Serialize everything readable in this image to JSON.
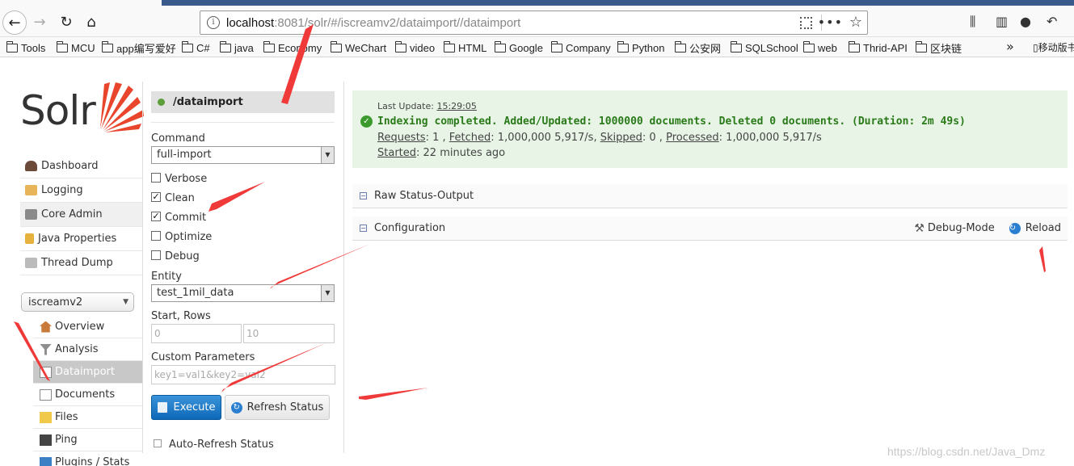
{
  "browser": {
    "url_prefix": "localhost",
    "url_rest": ":8081/solr/#/iscreamv2/dataimport//dataimport",
    "bookmarks": [
      "Tools",
      "MCU",
      "app编写爱好",
      "C#",
      "java",
      "Economy",
      "WeChart",
      "video",
      "HTML",
      "Google",
      "Company",
      "Python",
      "公安网",
      "SQLSchool",
      "web",
      "Thrid-API",
      "区块链"
    ],
    "bookmarks_overflow": "»",
    "mobile_bookmarks": "移动版书签"
  },
  "logo": {
    "text": "Solr"
  },
  "sidebar": {
    "items": [
      "Dashboard",
      "Logging",
      "Core Admin",
      "Java Properties",
      "Thread Dump"
    ],
    "core_selector": "iscreamv2",
    "core_items": [
      "Overview",
      "Analysis",
      "Dataimport",
      "Documents",
      "Files",
      "Ping",
      "Plugins / Stats"
    ]
  },
  "form": {
    "handler": "/dataimport",
    "command_label": "Command",
    "command_value": "full-import",
    "verbose": "Verbose",
    "clean": "Clean",
    "commit": "Commit",
    "optimize": "Optimize",
    "debug": "Debug",
    "entity_label": "Entity",
    "entity_value": "test_1mil_data",
    "start_rows_label": "Start, Rows",
    "start_placeholder": "0",
    "rows_placeholder": "10",
    "custom_label": "Custom Parameters",
    "custom_placeholder": "key1=val1&key2=val2",
    "execute": "Execute",
    "refresh": "Refresh Status",
    "auto_refresh": "Auto-Refresh Status"
  },
  "status": {
    "last_update_label": "Last Update:",
    "last_update_time": "15:29:05",
    "message": "Indexing completed. Added/Updated: 1000000 documents. Deleted 0 documents. (Duration: 2m 49s)",
    "requests_label": "Requests",
    "requests_value": ": 1 , ",
    "fetched_label": "Fetched",
    "fetched_value": ": 1,000,000 5,917/s, ",
    "skipped_label": "Skipped",
    "skipped_value": ": 0 , ",
    "processed_label": "Processed",
    "processed_value": ": 1,000,000 5,917/s",
    "started_label": "Started",
    "started_value": ": 22 minutes ago"
  },
  "sections": {
    "raw": "Raw Status-Output",
    "config": "Configuration",
    "debug_mode": "Debug-Mode",
    "reload": "Reload"
  },
  "watermark": "https://blog.csdn.net/Java_Dmz",
  "colors": {
    "execute_button": "#1a73c4",
    "status_bg": "#e8f5e6",
    "success_text": "#2a7a1a",
    "arrow": "#f03a3a"
  }
}
